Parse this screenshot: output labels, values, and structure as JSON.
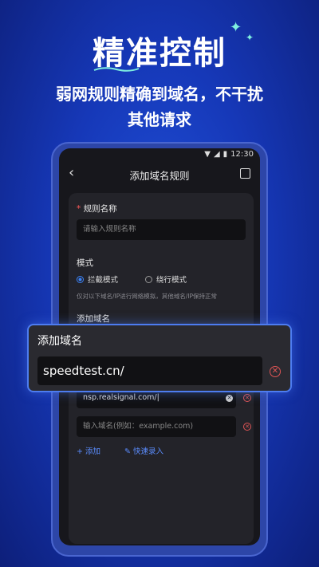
{
  "promo": {
    "headline": "精准控制",
    "subline1": "弱网规则精确到域名，不干扰",
    "subline2": "其他请求"
  },
  "statusbar": {
    "time": "12:30"
  },
  "nav": {
    "title": "添加域名规则"
  },
  "form": {
    "rule_name_label": "规则名称",
    "required_mark": "*",
    "rule_name_placeholder": "请输入规则名称",
    "mode_label": "模式",
    "mode_options": [
      "拦截模式",
      "绕行模式"
    ],
    "mode_selected": "拦截模式",
    "mode_hint": "仅对以下域名/IP进行网络模拟，其他域名/IP保持正常",
    "domain_label": "添加域名",
    "domains": [
      "nsp.realsignal.com/|"
    ],
    "domain_placeholder": "输入域名(例如：example.com)",
    "add_label": "+ 添加",
    "quick_entry_label": "快速录入"
  },
  "overlay": {
    "title": "添加域名",
    "value": "speedtest.cn/"
  },
  "colors": {
    "accent": "#3b82f6",
    "danger": "#e05555",
    "brand_bg": "#1638b8"
  }
}
